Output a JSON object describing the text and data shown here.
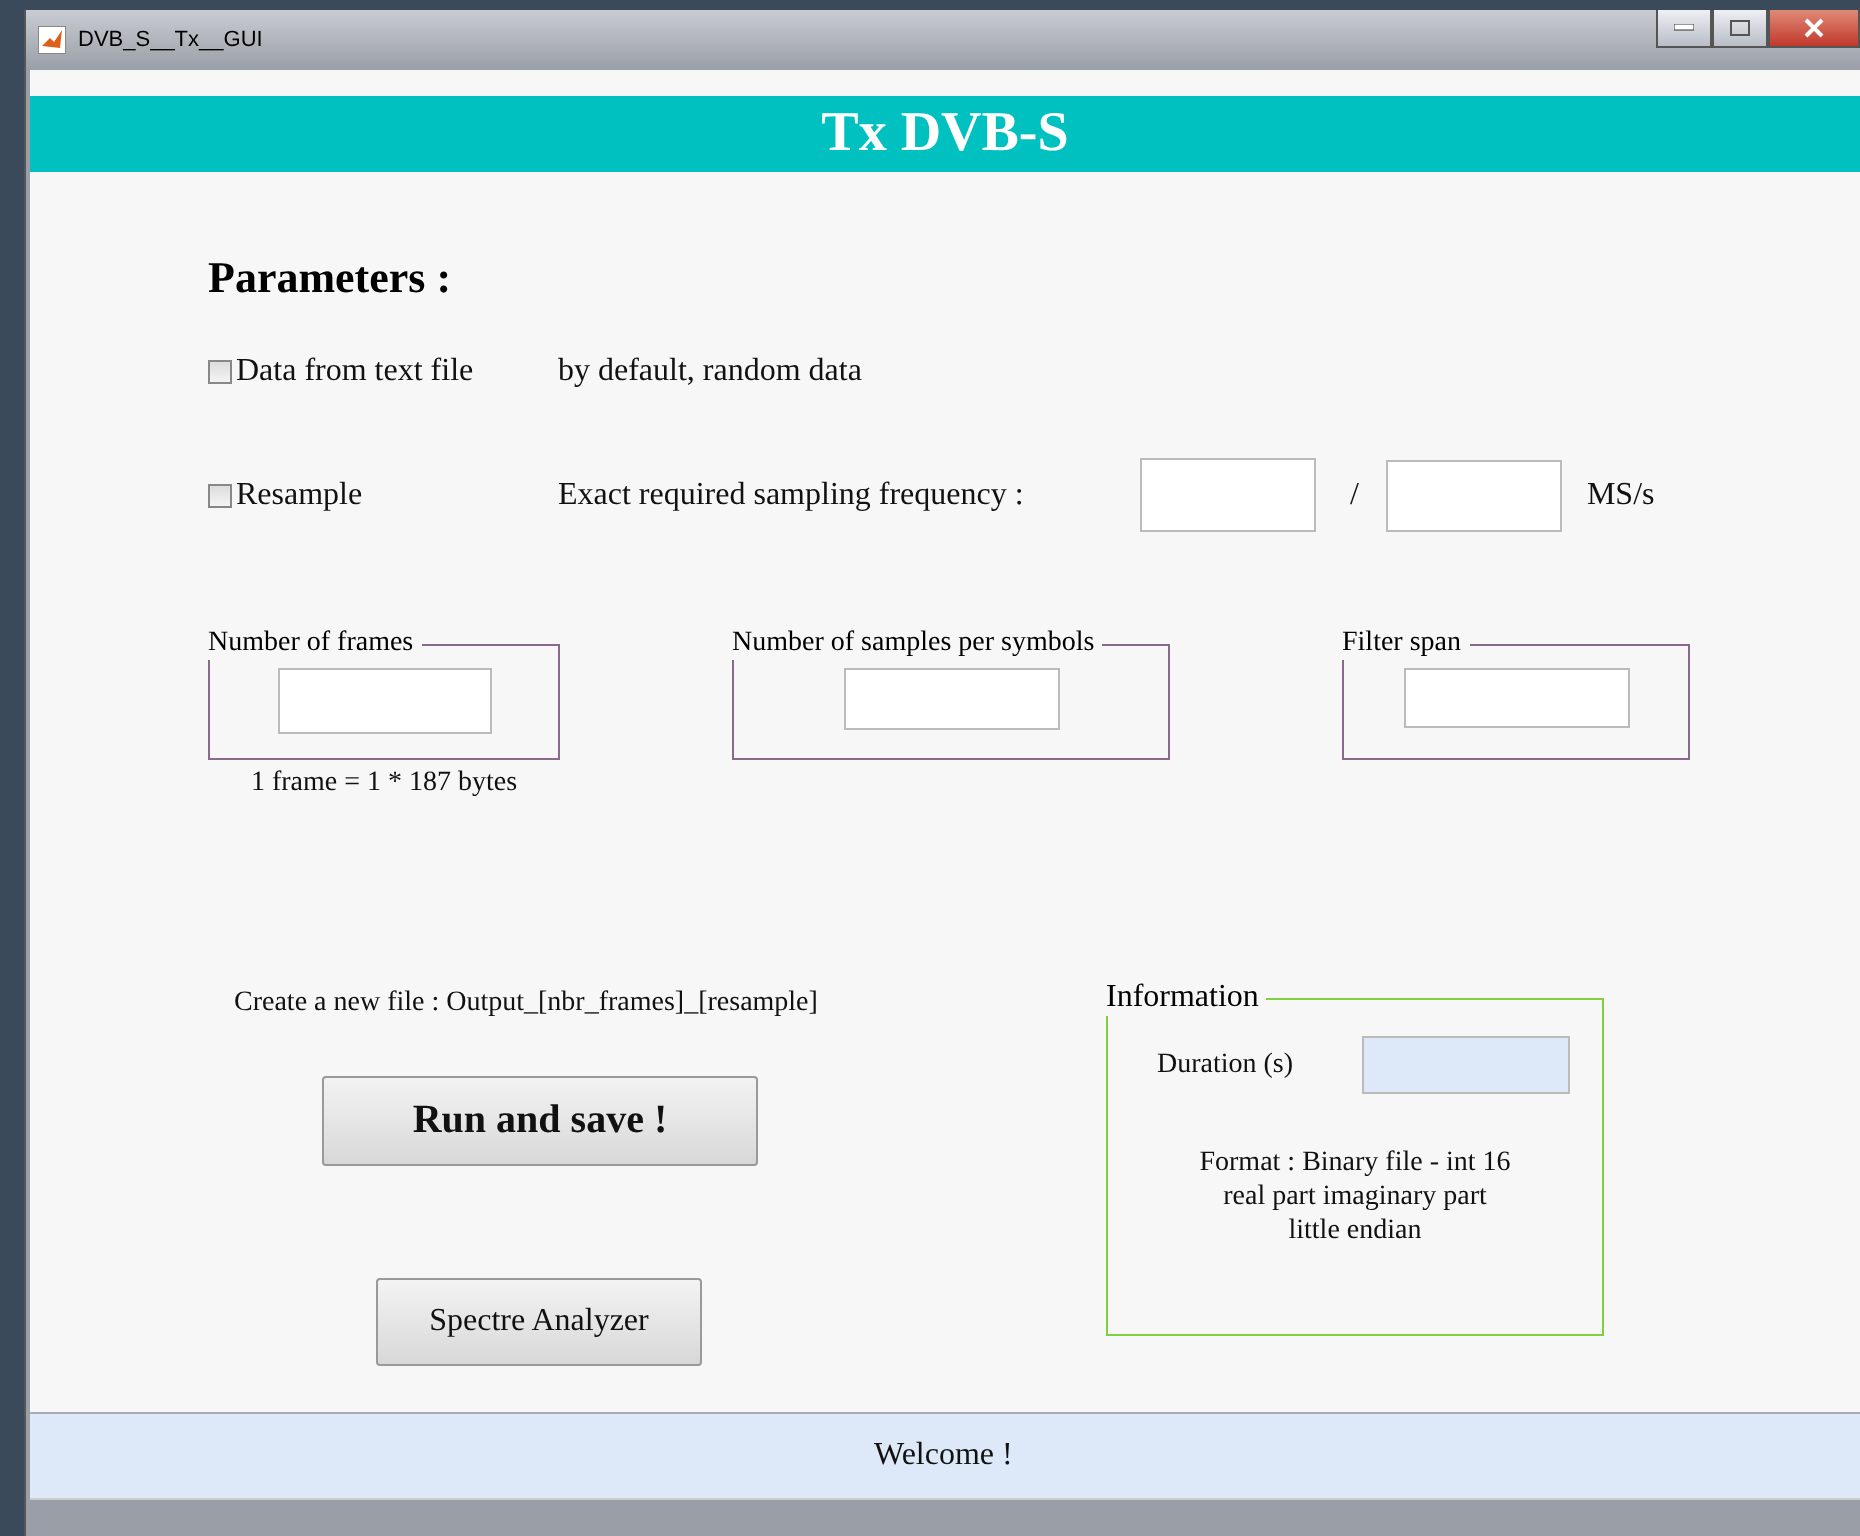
{
  "window": {
    "title": "DVB_S__Tx__GUI"
  },
  "header": "Tx DVB-S",
  "parameters_title": "Parameters :",
  "options": [
    {
      "label": "Data from text file",
      "checked": false,
      "note": "by default, random data"
    },
    {
      "label": "Resample",
      "checked": false,
      "note": "Exact required sampling frequency :"
    }
  ],
  "sampling": {
    "separator": "/",
    "unit": "MS/s"
  },
  "groups": [
    {
      "title": "Number of frames",
      "caption": "1 frame = 1 * 187 bytes"
    },
    {
      "title": "Number of samples per symbols"
    },
    {
      "title": "Filter span"
    }
  ],
  "output_note": "Create a new file : Output_[nbr_frames]_[resample]",
  "buttons": [
    {
      "label": "Run and save !",
      "kind": "primary"
    },
    {
      "label": "Spectre Analyzer",
      "kind": "secondary"
    }
  ],
  "information": {
    "title": "Information",
    "duration_label": "Duration (s)",
    "format_lines": [
      "Format : Binary file - int 16",
      "real part imaginary part",
      "little endian"
    ]
  },
  "status_bar": "Welcome !"
}
